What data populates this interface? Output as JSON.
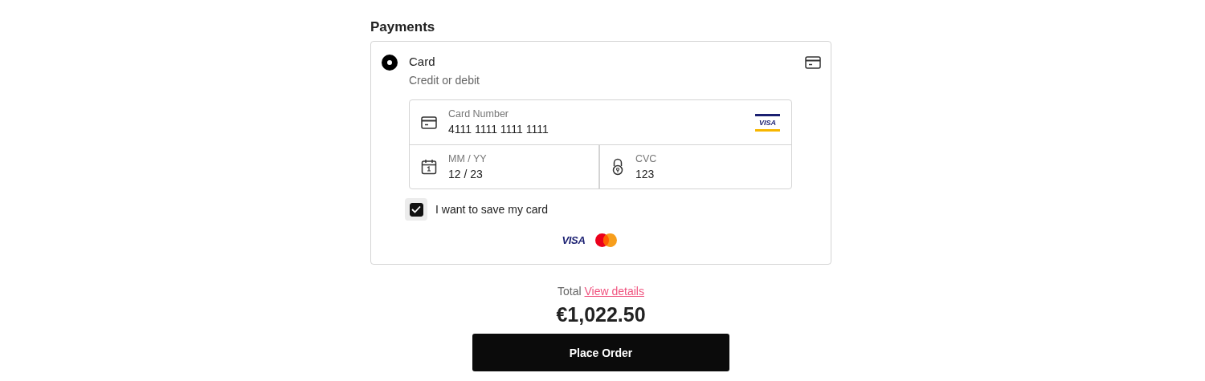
{
  "section_title": "Payments",
  "payment_methods": [
    {
      "label": "Card",
      "description": "Credit or debit",
      "selected": true
    }
  ],
  "card_form": {
    "card_number": {
      "label": "Card Number",
      "value": "4111 1111 1111 1111",
      "brand_badge": "VISA"
    },
    "expiry": {
      "label": "MM / YY",
      "value": "12 / 23"
    },
    "cvc": {
      "label": "CVC",
      "value": "123"
    }
  },
  "save_card": {
    "label": "I want to save my card",
    "checked": true
  },
  "accepted_brands": [
    {
      "kind": "visa",
      "label": "VISA"
    },
    {
      "kind": "mastercard"
    }
  ],
  "total": {
    "label": "Total",
    "link": "View details",
    "amount": "€1,022.50"
  },
  "submit_button": "Place Order"
}
